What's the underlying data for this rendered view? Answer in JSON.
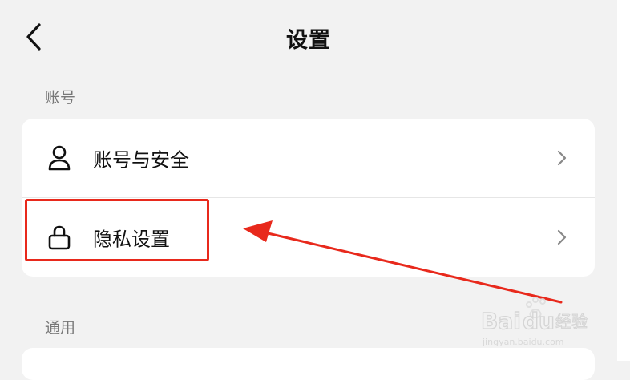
{
  "header": {
    "title": "设置",
    "back_icon": "chevron-left-icon"
  },
  "sections": [
    {
      "label": "账号",
      "items": [
        {
          "label": "账号与安全",
          "icon": "user-icon"
        },
        {
          "label": "隐私设置",
          "icon": "lock-icon"
        }
      ]
    },
    {
      "label": "通用"
    }
  ],
  "annotation": {
    "color": "#e8291c"
  },
  "watermark": {
    "brand": "Baidu经验",
    "url": "jingyan.baidu.com"
  }
}
